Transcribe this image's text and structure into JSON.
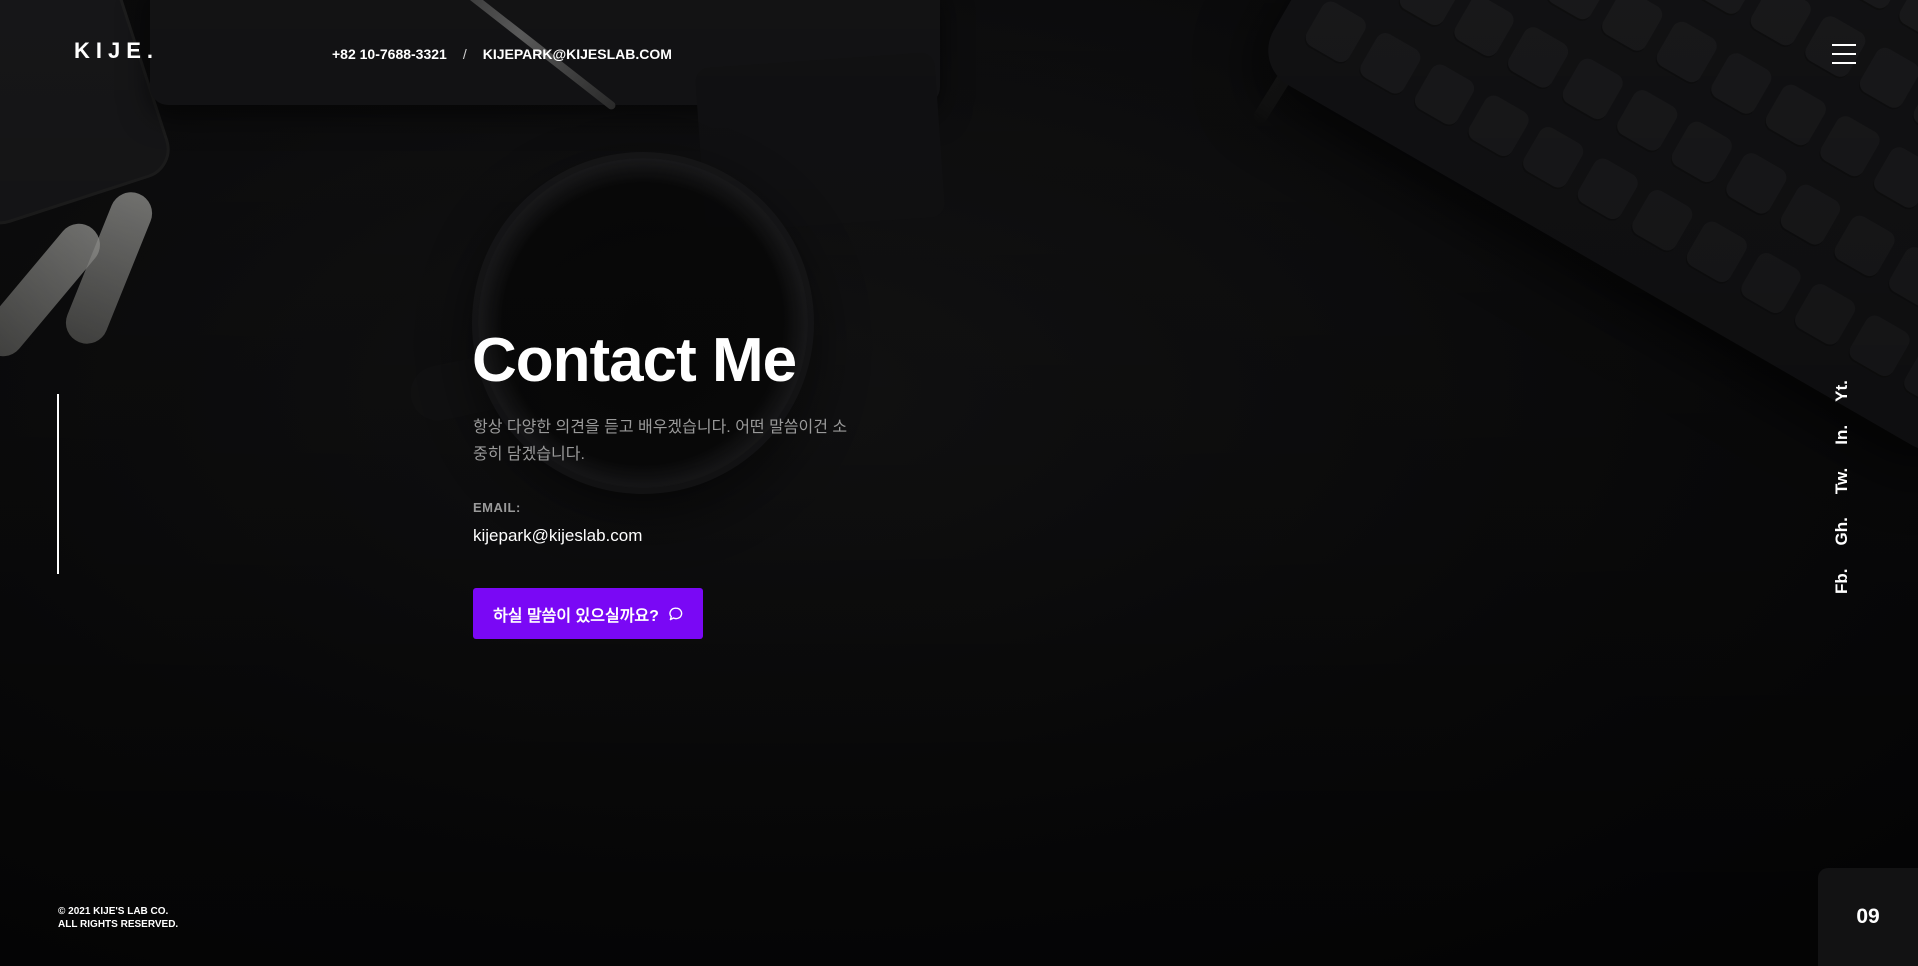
{
  "header": {
    "logo": "KIJE.",
    "phone": "+82 10-7688-3321",
    "separator": "/",
    "email": "KIJEPARK@KIJESLAB.COM",
    "menu_icon": "hamburger-menu-icon"
  },
  "main": {
    "title": "Contact Me",
    "description": "항상 다양한 의견을 듣고 배우겠습니다. 어떤 말씀이건 소중히 담겠습니다.",
    "email_label": "EMAIL:",
    "email_value": "kijepark@kijeslab.com",
    "cta_label": "하실 말씀이 있으실까요?",
    "cta_icon": "chat-bubble-icon"
  },
  "social": {
    "items": [
      {
        "label": "Fb."
      },
      {
        "label": "Gh."
      },
      {
        "label": "Tw."
      },
      {
        "label": "In."
      },
      {
        "label": "Yt."
      }
    ]
  },
  "footer": {
    "copyright_line1": "© 2021 KIJE'S LAB CO.",
    "copyright_line2": "ALL RIGHTS RESERVED.",
    "page_number": "09"
  },
  "colors": {
    "accent": "#7a08f5",
    "background": "#0b0b0c",
    "muted_text": "#9a9a9a"
  }
}
